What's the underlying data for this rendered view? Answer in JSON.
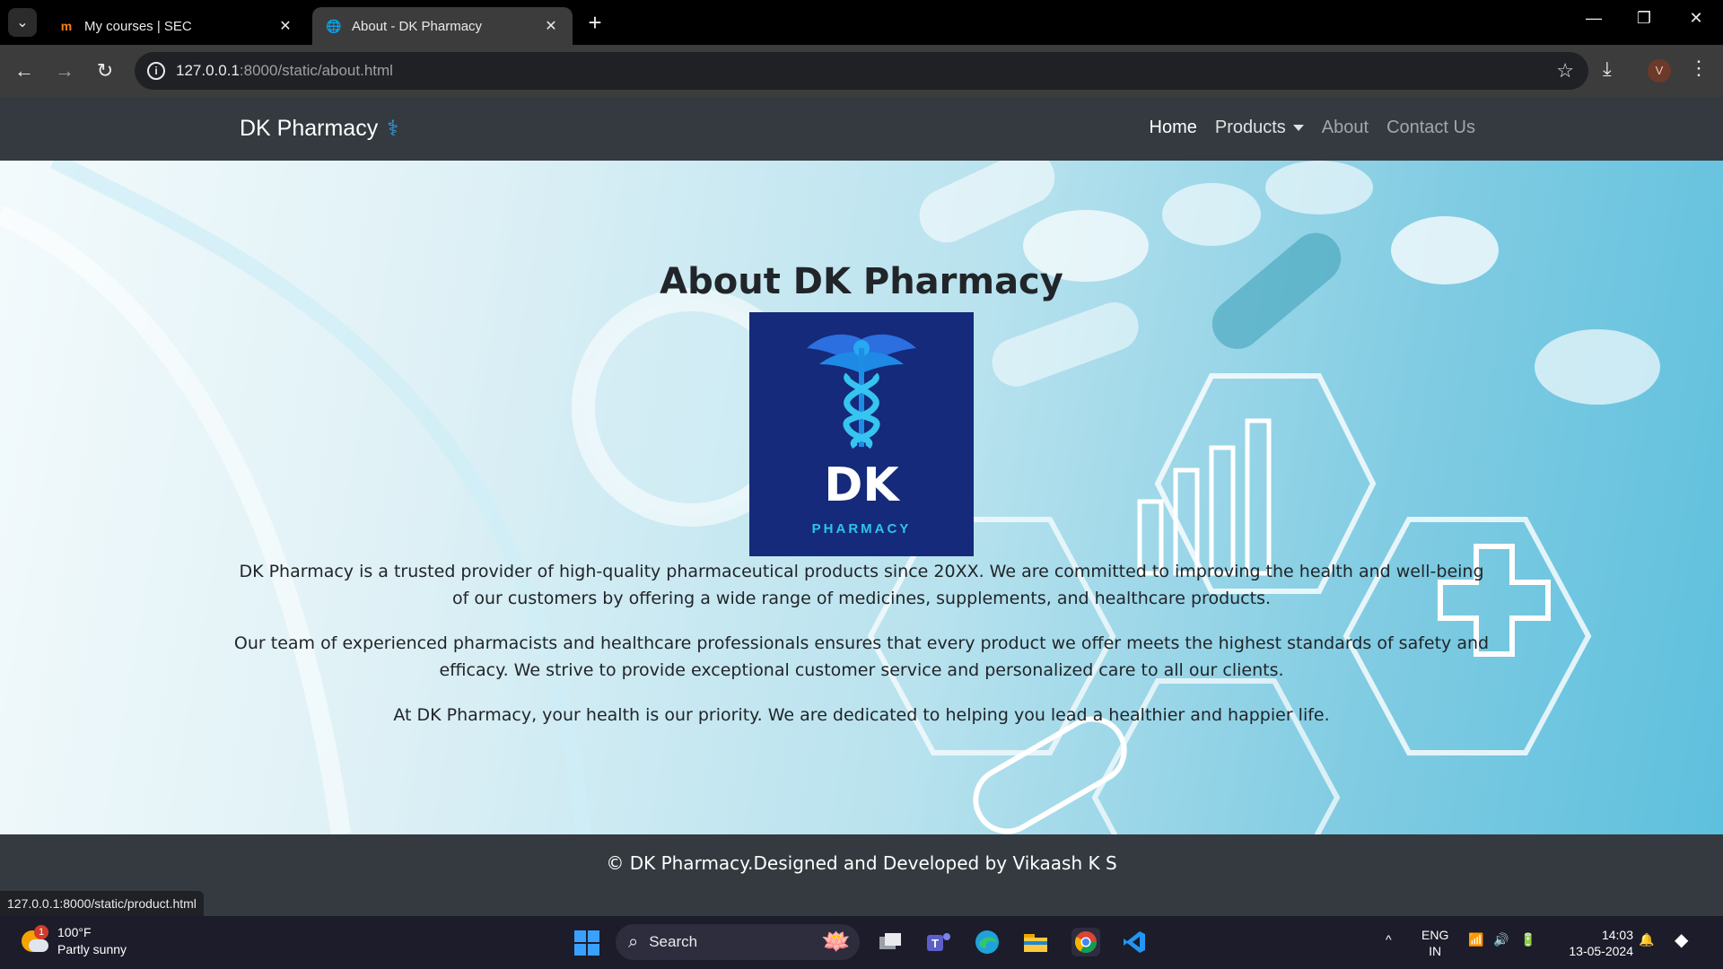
{
  "browser": {
    "tabs": [
      {
        "title": "My courses | SEC",
        "favicon": "moodle-icon",
        "active": false
      },
      {
        "title": "About - DK Pharmacy",
        "favicon": "globe-icon",
        "active": true
      }
    ],
    "url_host": "127.0.0.1",
    "url_rest": ":8000/static/about.html",
    "profile_initial": "V",
    "status_url": "127.0.0.1:8000/static/product.html"
  },
  "site": {
    "brand": "DK Pharmacy",
    "brand_icon": "caduceus-icon",
    "nav": {
      "home": "Home",
      "products": "Products",
      "about": "About",
      "contact": "Contact Us"
    }
  },
  "about": {
    "heading": "About DK Pharmacy",
    "logo_title": "DK",
    "logo_subtitle": "PHARMACY",
    "paragraphs": [
      "DK Pharmacy is a trusted provider of high-quality pharmaceutical products since 20XX. We are committed to improving the health and well-being of our customers by offering a wide range of medicines, supplements, and healthcare products.",
      "Our team of experienced pharmacists and healthcare professionals ensures that every product we offer meets the highest standards of safety and efficacy. We strive to provide exceptional customer service and personalized care to all our clients.",
      "At DK Pharmacy, your health is our priority. We are dedicated to helping you lead a healthier and happier life."
    ]
  },
  "footer": {
    "text": "© DK Pharmacy.Designed and Developed by Vikaash K S"
  },
  "taskbar": {
    "weather_temp": "100°F",
    "weather_desc": "Partly sunny",
    "weather_badge": "1",
    "search_label": "Search",
    "lang_line1": "ENG",
    "lang_line2": "IN",
    "time": "14:03",
    "date": "13-05-2024"
  },
  "colors": {
    "navbar": "#343a40",
    "logo_bg": "#152a7a",
    "accent": "#2fc3ef"
  }
}
